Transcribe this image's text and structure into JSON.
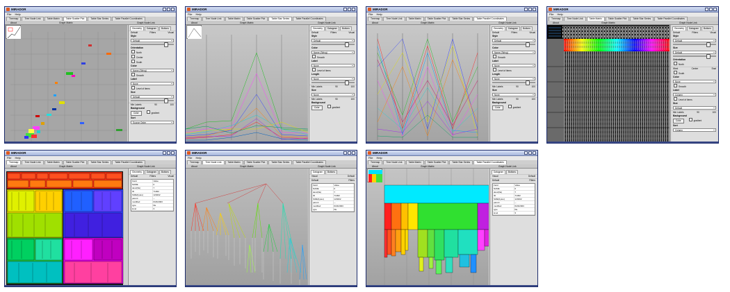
{
  "window_title": "MIRADOR",
  "menu": [
    "File",
    "Help"
  ],
  "tabs": [
    "Treemap",
    "Tree Node Link",
    "Table Matrix",
    "Table Scatter Plot",
    "Table Star Series",
    "Table Parallel Coordinates"
  ],
  "subtabs": {
    "about": "About",
    "graph_matrix": "Graph Matrix",
    "graph_node_link": "Graph Node Link",
    "view_tab": "Treemap",
    "scatter_tab": "Star coord"
  },
  "panel_tabs": [
    "Geometry",
    "Datagram",
    "Buttons"
  ],
  "panel_subtabs": [
    "Default",
    "Filters",
    "Visual"
  ],
  "panel": {
    "style": "Style",
    "default": "Default",
    "orientation": "Orientation",
    "north": "North",
    "west": "West",
    "center": "Center",
    "east": "East",
    "south": "South",
    "color": "Color",
    "column": "Column",
    "name_string": "Name (String)",
    "smooth": "Smooth",
    "label": "Label",
    "level_items": "Level of items",
    "length": "Length",
    "size": "Size",
    "min_labels": "Min Labels",
    "min_val": "90",
    "max_val": "100",
    "background": "Background",
    "color_btn": "Color",
    "gradient": "gradient",
    "sort": "Sort",
    "column_label": "Column",
    "source_order": "Source Order",
    "values": "Values",
    "none": "None",
    "default_label": "Default"
  },
  "table": {
    "headers": [
      "Field",
      "Value"
    ],
    "rows": [
      [
        "NAME",
        "0"
      ],
      [
        "desc(file)",
        "7"
      ],
      [
        "ID",
        "71302"
      ],
      [
        "SIZE(bytes)",
        "120202"
      ],
      [
        "parent",
        "--"
      ],
      [
        "modified",
        "6/23/2003"
      ],
      [
        "type",
        "file"
      ],
      [
        "level",
        "3"
      ]
    ]
  },
  "colors": {
    "accent": "#1b2a6b",
    "title_bg": "#c4d0ec",
    "view_bg": "#a8a8a8"
  }
}
